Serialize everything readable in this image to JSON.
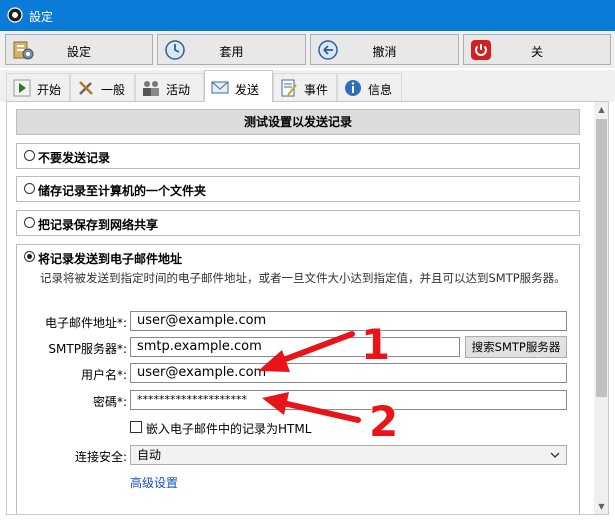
{
  "window": {
    "title": "設定"
  },
  "toolbar": {
    "buttons": [
      {
        "label": "設定",
        "icon": "settings-icon"
      },
      {
        "label": "套用",
        "icon": "apply-icon"
      },
      {
        "label": "撤消",
        "icon": "undo-icon"
      },
      {
        "label": "关",
        "icon": "power-icon"
      }
    ]
  },
  "tabs": [
    {
      "label": "开始",
      "icon": "play-icon"
    },
    {
      "label": "一般",
      "icon": "tools-icon"
    },
    {
      "label": "活动",
      "icon": "activity-icon"
    },
    {
      "label": "发送",
      "icon": "send-mail-icon",
      "active": true
    },
    {
      "label": "事件",
      "icon": "event-icon"
    },
    {
      "label": "信息",
      "icon": "info-icon"
    }
  ],
  "panel": {
    "header": "测试设置以发送记录",
    "options": [
      {
        "label": "不要发送记录",
        "checked": false
      },
      {
        "label": "储存记录至计算机的一个文件夹",
        "checked": false
      },
      {
        "label": "把记录保存到网络共享",
        "checked": false
      },
      {
        "label": "将记录发送到电子邮件地址",
        "checked": true
      }
    ],
    "email": {
      "description": "记录将被发送到指定时间的电子邮件地址，或者一旦文件大小达到指定值，并且可以达到SMTP服务器。",
      "email_label": "电子邮件地址*:",
      "email_value": "user@example.com",
      "smtp_label": "SMTP服务器*:",
      "smtp_value": "smtp.example.com",
      "smtp_search_button": "搜索SMTP服务器",
      "username_label": "用户名*:",
      "username_value": "user@example.com",
      "password_label": "密碼*:",
      "password_value": "********************",
      "embed_label": "嵌入电子邮件中的记录为HTML",
      "embed_checked": false,
      "security_label": "连接安全:",
      "security_value": "自动",
      "advanced_link": "高级设置"
    }
  },
  "annotations": {
    "arrow1_number": "1",
    "arrow2_number": "2",
    "color": "#e8141a"
  },
  "colors": {
    "titlebar": "#0a7bd6",
    "link": "#1a4fc4"
  }
}
